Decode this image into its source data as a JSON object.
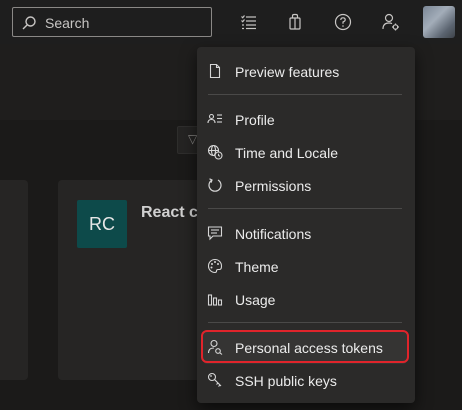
{
  "search": {
    "placeholder": "Search"
  },
  "toolbar": {
    "icons": [
      "task-list-icon",
      "shopping-bag-icon",
      "help-icon",
      "user-settings-icon"
    ]
  },
  "card": {
    "initials": "RC",
    "title": "React c"
  },
  "menu": {
    "groups": [
      [
        {
          "label": "Preview features",
          "icon": "document-icon"
        }
      ],
      [
        {
          "label": "Profile",
          "icon": "profile-card-icon"
        },
        {
          "label": "Time and Locale",
          "icon": "globe-clock-icon"
        },
        {
          "label": "Permissions",
          "icon": "permissions-icon"
        }
      ],
      [
        {
          "label": "Notifications",
          "icon": "notification-chat-icon"
        },
        {
          "label": "Theme",
          "icon": "palette-icon"
        },
        {
          "label": "Usage",
          "icon": "bar-chart-icon"
        }
      ],
      [
        {
          "label": "Personal access tokens",
          "icon": "token-user-icon"
        },
        {
          "label": "SSH public keys",
          "icon": "key-icon"
        }
      ]
    ],
    "highlighted": "Personal access tokens"
  },
  "colors": {
    "highlight_border": "#e0242b",
    "badge": "#0d4a4a"
  }
}
